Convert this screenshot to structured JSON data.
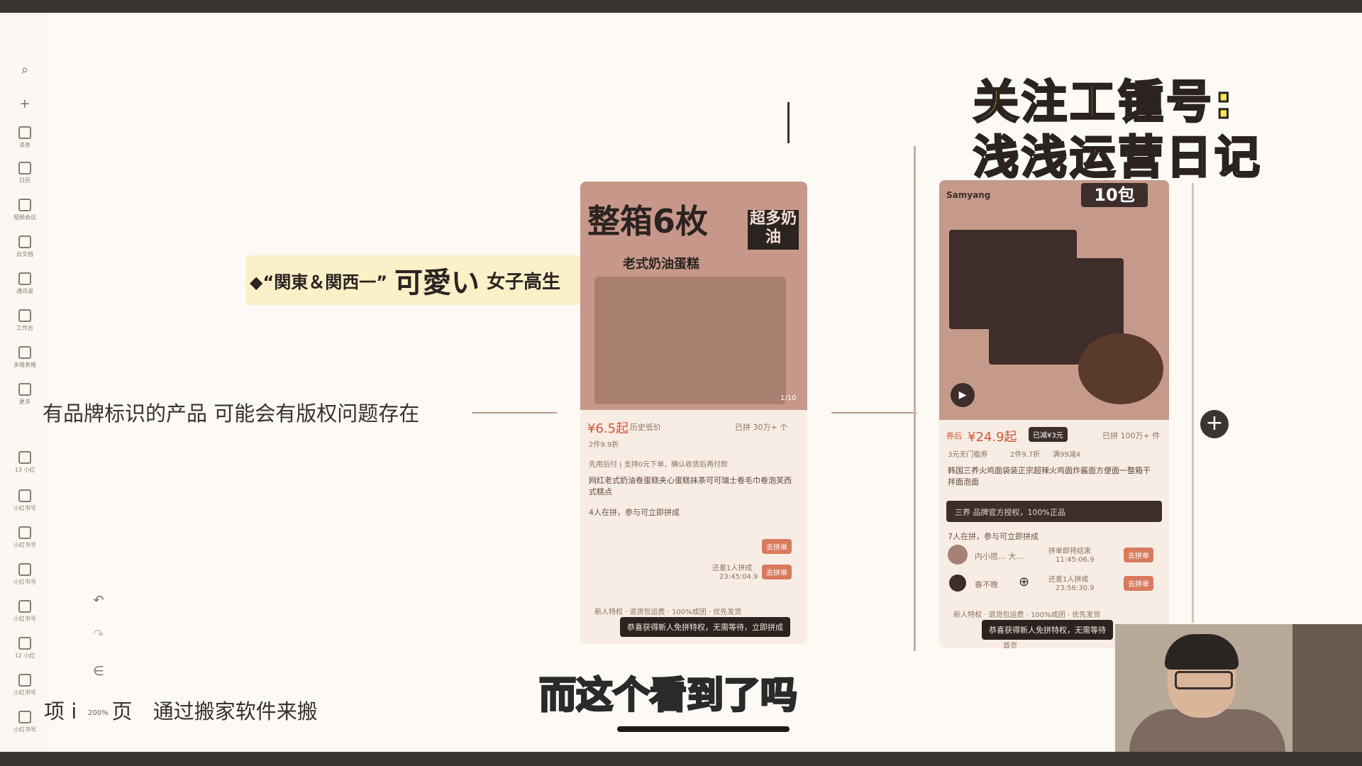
{
  "overlay": {
    "promo_line1": "关注工锺号:",
    "promo_line2": "浅浅运营日记",
    "subtitle": "而这个看到了吗"
  },
  "mindmap": {
    "banner_a": "◆“関東＆関西一”",
    "banner_b": "可愛い",
    "banner_c": "女子高生",
    "note_copyright": "有品牌标识的产品 可能会有版权问题存在",
    "note_move_prefix": "项 i",
    "note_move_page": "页",
    "note_move": "通过搬家软件来搬",
    "zoom": "200%"
  },
  "sidebar": {
    "items": [
      {
        "label": "消息"
      },
      {
        "label": "日历"
      },
      {
        "label": "视频会议"
      },
      {
        "label": "云文档"
      },
      {
        "label": "通讯录"
      },
      {
        "label": "工作台"
      },
      {
        "label": "多维表格"
      },
      {
        "label": "更多"
      },
      {
        "label": "13 小红"
      },
      {
        "label": "小红书号"
      },
      {
        "label": "小红书号"
      },
      {
        "label": "小红书号"
      },
      {
        "label": "小红书号"
      },
      {
        "label": "12 小红"
      },
      {
        "label": "小红书号"
      },
      {
        "label": "小红书号"
      }
    ]
  },
  "card1": {
    "title_big": "整箱6枚",
    "tag": "超多奶油",
    "subtitle": "老式奶油蛋糕",
    "page": "1/10",
    "price": "¥6.5起",
    "price_note": "历史低价",
    "sold": "已拼 30万+ 个",
    "discount": "2件9.9折",
    "guarantee": "先用后付 | 支持0元下单，确认收货后再付款",
    "name": "网红老式奶油卷蛋糕夹心蛋糕抹茶可可瑞士卷毛巾卷泡芙西式糕点",
    "group": "4人在拼，参与可立即拼成",
    "remain": "还差1人拼成",
    "time": "23:45:04.9",
    "join": "去拼单",
    "newuser": "新人特权 · 退货包运费 · 100%成团 · 优先发货",
    "toast": "恭喜获得新人免拼特权，无需等待，立即拼成"
  },
  "card2": {
    "brand": "Samyang",
    "pack": "10包",
    "price_label": "券后",
    "price": "¥24.9起",
    "badge": "已减¥3元",
    "sold": "已拼 100万+ 件",
    "coupon1": "3元无门槛券",
    "coupon2": "2件9.7折",
    "coupon3": "满99减4",
    "name": "韩国三养火鸡面袋装正宗超辣火鸡面炸酱面方便面一整箱干拌面泡面",
    "brand_line": "三养  品牌官方授权，100%正品",
    "group": "7人在拼，参与可立即拼成",
    "u1": "内小揽…  大…",
    "u1_note": "拼单即将结束",
    "u1_time": "11:45:06.9",
    "u2": "春不晚",
    "u2_note": "还差1人拼成",
    "u2_time": "23:56:30.9",
    "join": "去拼单",
    "newuser": "新人特权 · 退货包运费 · 100%成团 · 优先发货",
    "toast": "恭喜获得新人免拼特权，无需等待",
    "home": "首页"
  },
  "colors": {
    "promo_yellow": "#f8e84a",
    "price_red": "#d9532f",
    "canvas": "#fdfaf6"
  }
}
